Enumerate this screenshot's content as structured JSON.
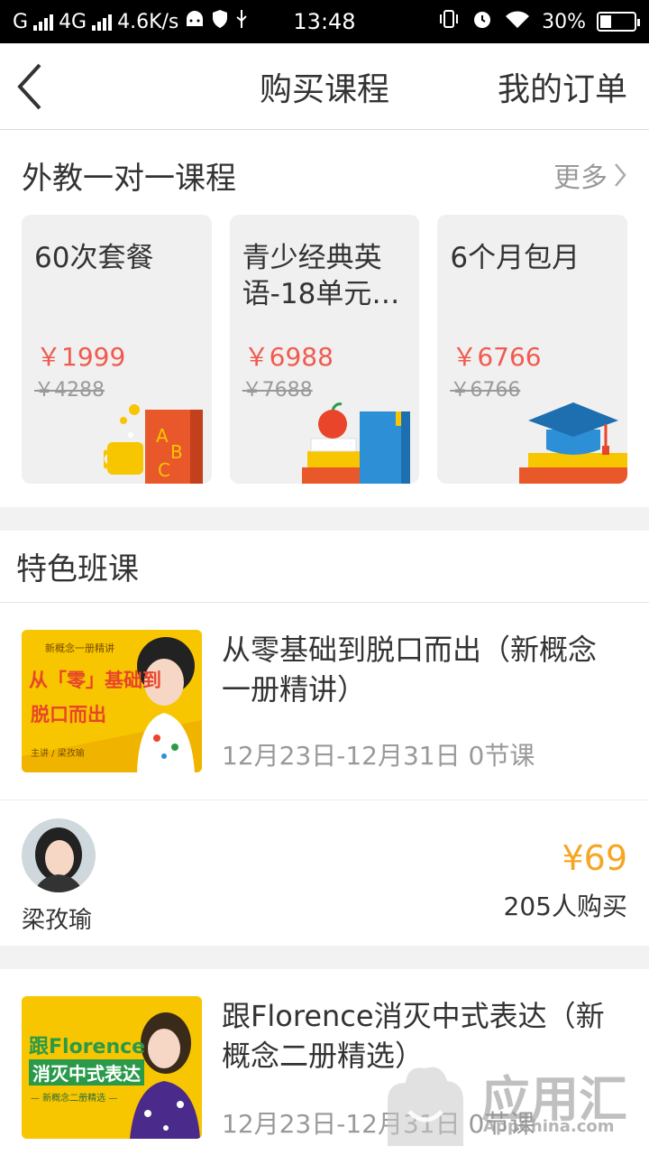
{
  "status_bar": {
    "carrier1": "G",
    "carrier2": "4G",
    "speed": "4.6K/s",
    "time": "13:48",
    "battery": "30%"
  },
  "nav": {
    "title": "购买课程",
    "action": "我的订单"
  },
  "section1": {
    "title": "外教一对一课程",
    "more": "更多"
  },
  "cards": [
    {
      "title": "60次套餐",
      "price": "￥1999",
      "old_price": "￥4288"
    },
    {
      "title": "青少经典英语-18单元+…",
      "price": "￥6988",
      "old_price": "￥7688"
    },
    {
      "title": "6个月包月",
      "price": "￥6766",
      "old_price": "￥6766"
    }
  ],
  "featured": {
    "title": "特色班课",
    "courses": [
      {
        "title": "从零基础到脱口而出（新概念一册精讲）",
        "meta": "12月23日-12月31日 0节课",
        "thumb_top": "新概念一册精讲",
        "thumb_main1": "从「零」基础到",
        "thumb_main2": "脱口而出",
        "thumb_sub": "主讲 / 梁孜瑜",
        "teacher": "梁孜瑜",
        "price": "¥69",
        "buyers": "205人购买"
      },
      {
        "title": "跟Florence消灭中式表达（新概念二册精选）",
        "meta": "12月23日-12月31日 0节课",
        "thumb_main1": "跟Florence",
        "thumb_main2": "消灭中式表达",
        "thumb_sub": "— 新概念二册精选 —"
      }
    ]
  },
  "watermark": {
    "name": "应用汇",
    "domain": "AppChina.com"
  },
  "colors": {
    "price_red": "#f05a4f",
    "price_orange": "#f5a623",
    "card_bg": "#f0f0f0",
    "thumb_yellow": "#f7c600"
  }
}
